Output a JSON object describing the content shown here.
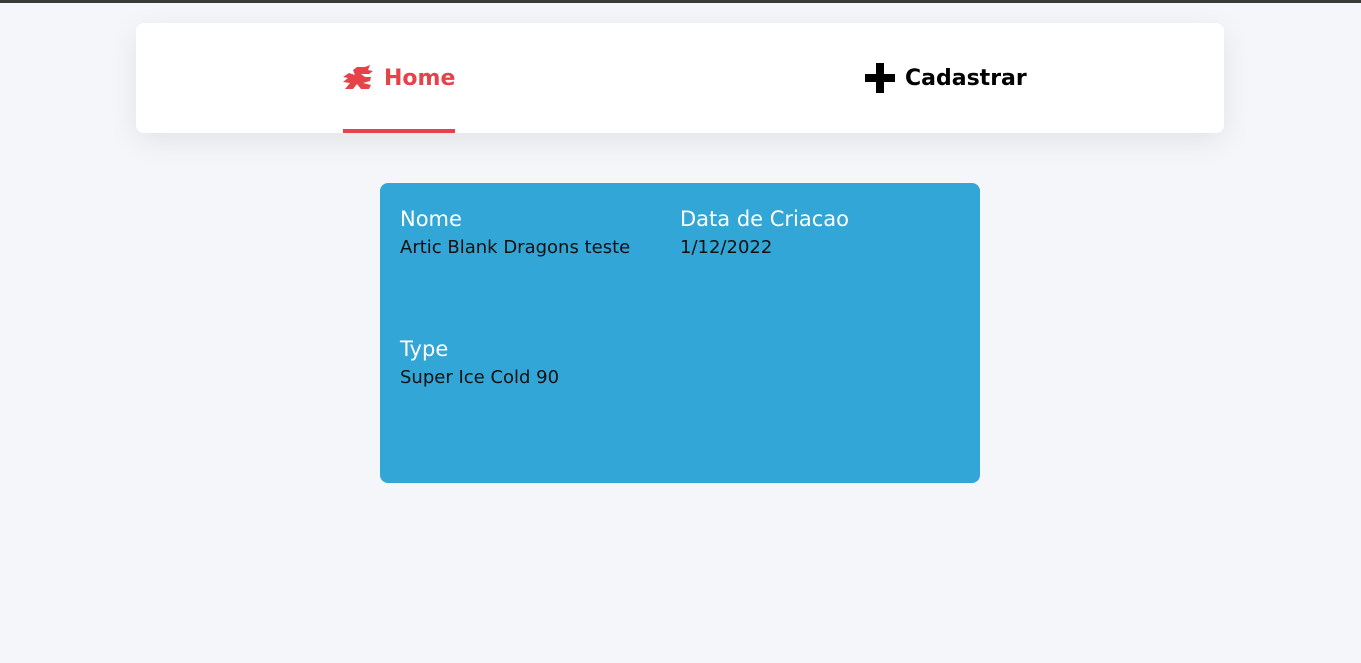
{
  "nav": {
    "home_label": "Home",
    "home_icon": "dragon-icon",
    "cadastrar_label": "Cadastrar",
    "cadastrar_icon": "plus-icon",
    "active_color": "#e6424a"
  },
  "card": {
    "background": "#32a6d7",
    "nome_label": "Nome",
    "nome_value": "Artic Blank Dragons teste",
    "data_label": "Data de Criacao",
    "data_value": "1/12/2022",
    "type_label": "Type",
    "type_value": "Super Ice Cold 90"
  }
}
